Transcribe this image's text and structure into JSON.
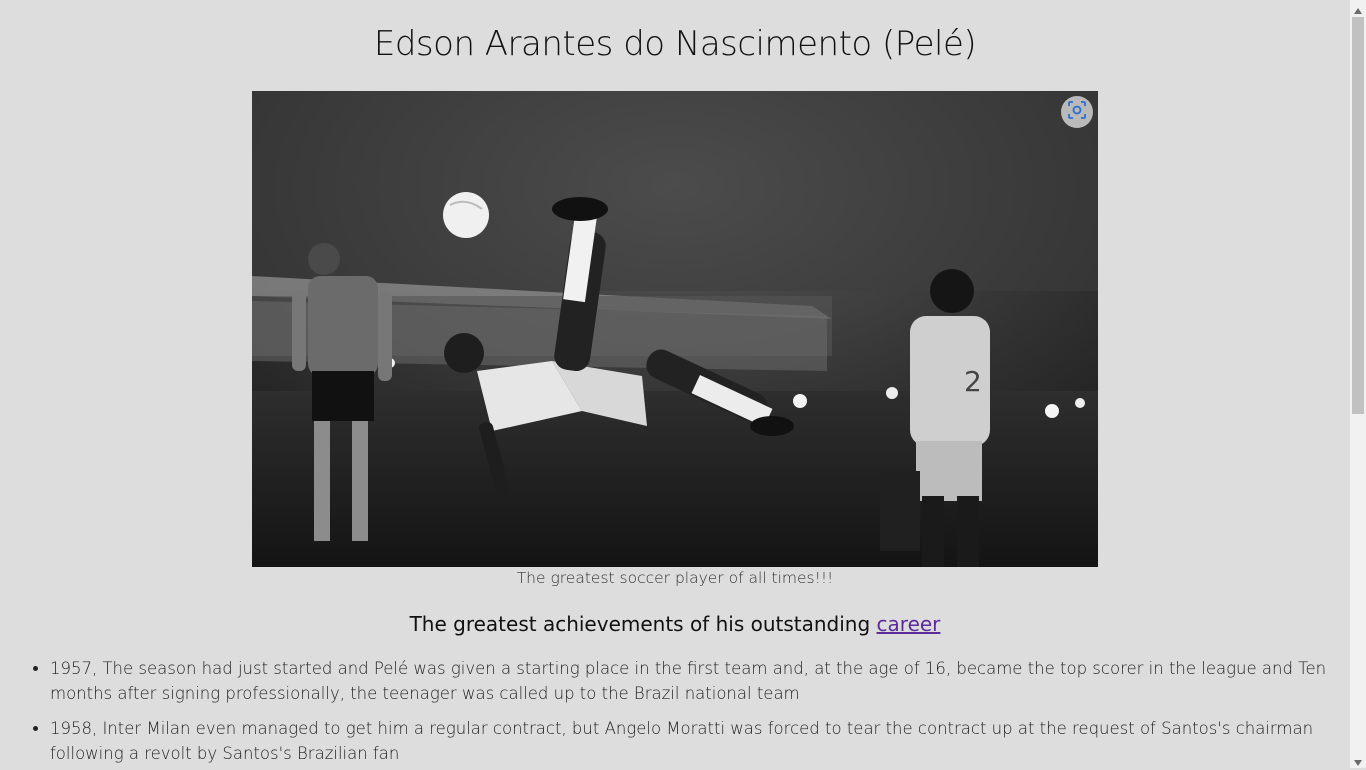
{
  "page": {
    "title": "Edson Arantes do Nascimento (Pelé)",
    "caption": "The greatest soccer player of all times!!!",
    "subheading_text": "The greatest achievements of his outstanding ",
    "subheading_link": "career",
    "achievements": [
      "1957, The season had just started and Pelé was given a starting place in the first team and, at the age of 16, became the top scorer in the league and Ten months after signing professionally, the teenager was called up to the Brazil national team",
      "1958, Inter Milan even managed to get him a regular contract, but Angelo Moratti was forced to tear the contract up at the request of Santos's chairman following a revolt by Santos's Brazilian fan"
    ]
  },
  "colors": {
    "background": "#dddddd",
    "link": "#5b2b9a"
  },
  "icons": {
    "image_search": "lens-icon",
    "scroll_up": "arrow-up-icon",
    "scroll_down": "arrow-down-icon"
  }
}
